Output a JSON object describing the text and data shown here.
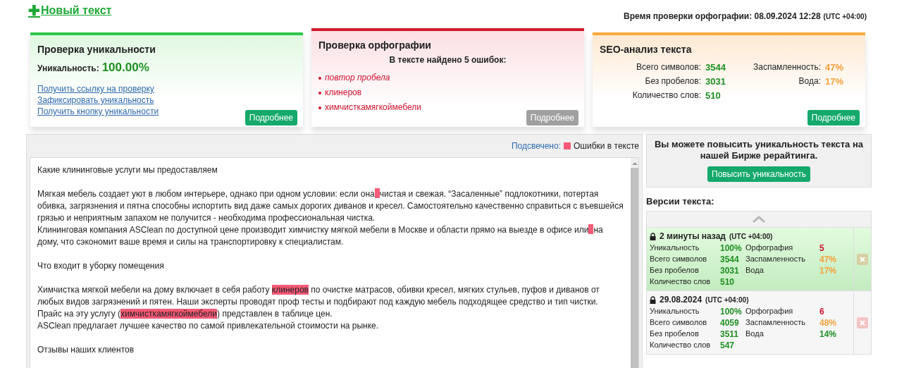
{
  "new_text_link": {
    "icon": "✚",
    "label": "Новый текст"
  },
  "check_time": {
    "label": "Время проверки орфографии: 08.09.2024 12:28",
    "timezone": "(UTC +04:00)"
  },
  "uniqueness_card": {
    "title": "Проверка уникальности",
    "label": "Уникальность:",
    "value": "100.00%",
    "links": [
      "Получить ссылку на проверку",
      "Зафиксировать уникальность",
      "Получить кнопку уникальности"
    ],
    "button": {
      "label": "Подробнее",
      "disabled": false
    }
  },
  "spelling_card": {
    "title": "Проверка орфографии",
    "summary": "В тексте найдено 5 ошибок:",
    "errors": [
      {
        "text": "повтор пробела",
        "kind": "space"
      },
      {
        "text": "клинеров",
        "kind": "word"
      },
      {
        "text": "химчисткамягкоймебели",
        "kind": "word"
      }
    ],
    "button": {
      "label": "Подробнее",
      "disabled": true
    }
  },
  "seo_card": {
    "title": "SEO-анализ текста",
    "stats": [
      {
        "label": "Всего символов:",
        "value": "3544",
        "color": "#1e8f22"
      },
      {
        "label": "Заспамленность:",
        "value": "47%",
        "color": "#f6a03a"
      },
      {
        "label": "Без пробелов:",
        "value": "3031",
        "color": "#1e8f22"
      },
      {
        "label": "Вода:",
        "value": "17%",
        "color": "#f6a03a"
      },
      {
        "label": "Количество слов:",
        "value": "510",
        "color": "#1e8f22"
      }
    ],
    "button": {
      "label": "Подробнее",
      "disabled": false
    }
  },
  "legend": {
    "label": "Подсвечено:",
    "item": "Ошибки в тексте"
  },
  "editor": {
    "paragraphs": [
      {
        "lines": [
          [
            {
              "kind": "text",
              "text": "Какие клининговые услуги мы предоставляем"
            }
          ]
        ]
      },
      {
        "lines": [
          [
            {
              "kind": "text",
              "text": "Мягкая мебель создает уют в любом интерьере, однако при одном условии: если она"
            },
            {
              "kind": "space_error"
            },
            {
              "kind": "text",
              "text": "чистая и свежая. “Засаленные” подлокотники, потертая"
            }
          ],
          [
            {
              "kind": "text",
              "text": "обивка, загрязнения и пятна способны испортить вид даже самых дорогих диванов и кресел. Самостоятельно качественно справиться с въевшейся"
            }
          ],
          [
            {
              "kind": "text",
              "text": "грязью и неприятным запахом не получится - необходима профессиональная чистка."
            }
          ],
          [
            {
              "kind": "text",
              "text": "Клининговая компания ASClean по доступной цене производит химчистку мягкой мебели в Москве и области прямо на выезде в офисе или"
            },
            {
              "kind": "space_error"
            },
            {
              "kind": "text",
              "text": "на"
            }
          ],
          [
            {
              "kind": "text",
              "text": "дому, что сэкономит ваше время и силы на транспортировку к специалистам."
            }
          ]
        ]
      },
      {
        "lines": [
          [
            {
              "kind": "text",
              "text": "Что входит в уборку помещения"
            }
          ]
        ]
      },
      {
        "lines": [
          [
            {
              "kind": "text",
              "text": "Химчистка мягкой мебели на дому включает в себя работу "
            },
            {
              "kind": "error",
              "text": "клинеров"
            },
            {
              "kind": "text",
              "text": " по очистке матрасов, обивки кресел, мягких стульев, пуфов и диванов от"
            }
          ],
          [
            {
              "kind": "text",
              "text": "любых видов загрязнений и пятен. Наши эксперты проводят проф тесты и подбирают под каждую мебель подходящее средство и тип чистки."
            }
          ],
          [
            {
              "kind": "text",
              "text": "Прайс на эту услугу ("
            },
            {
              "kind": "error",
              "text": "химчисткамягкоймебели"
            },
            {
              "kind": "text",
              "text": ") представлен в таблице цен."
            }
          ],
          [
            {
              "kind": "text",
              "text": "ASClean предлагает лучшее качество по самой привлекательной стоимости на рынке."
            }
          ]
        ]
      },
      {
        "lines": [
          [
            {
              "kind": "text",
              "text": "Отзывы наших клиентов"
            }
          ]
        ]
      }
    ]
  },
  "promo": {
    "text": "Вы можете повысить уникальность текста на нашей Бирже рерайтинга.",
    "button": "Повысить уникальность"
  },
  "versions": {
    "title": "Версии текста:",
    "items": [
      {
        "title": "2 минуты назад",
        "timezone": "(UTC +04:00)",
        "selected": true,
        "stats": [
          {
            "label": "Уникальность",
            "value": "100%",
            "color": "#1e8f22"
          },
          {
            "label": "Орфография",
            "value": "5",
            "color": "#d2122e"
          },
          {
            "label": "Всего символов",
            "value": "3544",
            "color": "#1e8f22"
          },
          {
            "label": "Заспамленность",
            "value": "47%",
            "color": "#f6a03a"
          },
          {
            "label": "Без пробелов",
            "value": "3031",
            "color": "#1e8f22"
          },
          {
            "label": "Вода",
            "value": "17%",
            "color": "#f6a03a"
          },
          {
            "label": "Количество слов",
            "value": "510",
            "color": "#1e8f22"
          }
        ]
      },
      {
        "title": "29.08.2024",
        "timezone": "(UTC +04:00)",
        "selected": false,
        "stats": [
          {
            "label": "Уникальность",
            "value": "100%",
            "color": "#1e8f22"
          },
          {
            "label": "Орфография",
            "value": "6",
            "color": "#d2122e"
          },
          {
            "label": "Всего символов",
            "value": "4059",
            "color": "#1e8f22"
          },
          {
            "label": "Заспамленность",
            "value": "48%",
            "color": "#f6a03a"
          },
          {
            "label": "Без пробелов",
            "value": "3511",
            "color": "#1e8f22"
          },
          {
            "label": "Вода",
            "value": "14%",
            "color": "#1e8f22"
          },
          {
            "label": "Количество слов",
            "value": "547",
            "color": "#1e8f22"
          }
        ]
      }
    ]
  }
}
